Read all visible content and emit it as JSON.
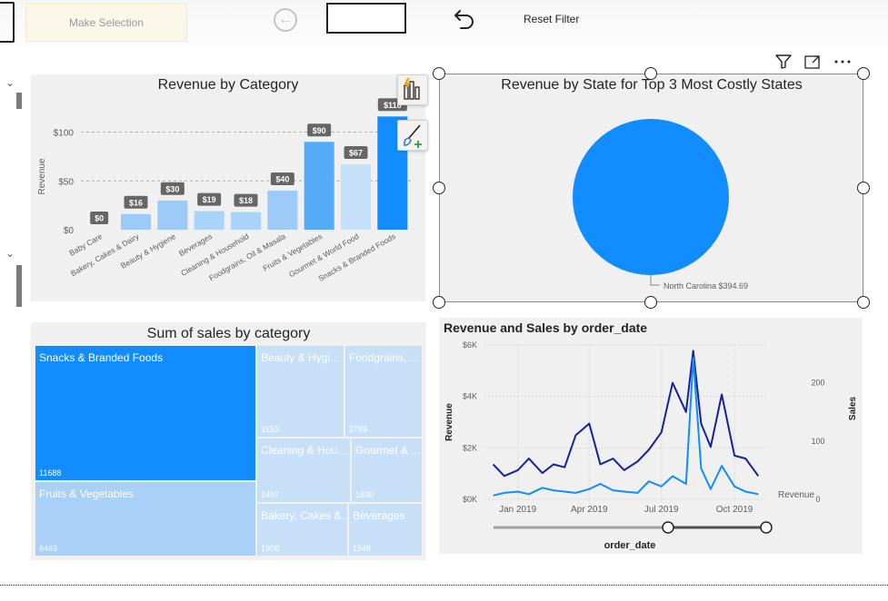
{
  "toolbar": {
    "make_selection_label": "Make Selection",
    "reset_filter_label": "Reset Filter"
  },
  "colors": {
    "accent_blue": "#118DFF",
    "light_blue": "#9DCBF7",
    "pale_blue": "#C5E0F9",
    "dark_navy": "#12239E",
    "card_bg": "#F0F0F0"
  },
  "chart_data": [
    {
      "type": "bar",
      "title": "Revenue by Category",
      "ylabel": "Revenue",
      "xlabel": "",
      "ylim": [
        0,
        120
      ],
      "yticks": [
        "$0",
        "$50",
        "$100"
      ],
      "ytick_values": [
        0,
        50,
        100
      ],
      "grid": true,
      "categories": [
        "Baby Care",
        "Bakery, Cakes & Dairy",
        "Beauty & Hygiene",
        "Beverages",
        "Cleaning & Household",
        "Foodgrains, Oil & Masala",
        "Fruits & Vegetables",
        "Gourmet & World Food",
        "Snacks & Branded Foods"
      ],
      "values": [
        0,
        16,
        30,
        19,
        18,
        40,
        90,
        67,
        116
      ],
      "data_labels": [
        "$0",
        "$16",
        "$30",
        "$19",
        "$18",
        "$40",
        "$90",
        "$67",
        "$116"
      ]
    },
    {
      "type": "pie",
      "title": "Revenue by State for Top 3 Most Costly States",
      "slices": [
        {
          "name": "North Carolina",
          "value": 394.69
        }
      ],
      "data_labels": [
        "North Carolina $394.69"
      ]
    },
    {
      "type": "treemap",
      "title": "Sum of sales by category",
      "items": [
        {
          "name": "Snacks & Branded Foods",
          "display_name": "Snacks & Branded Foods",
          "value": 11688
        },
        {
          "name": "Fruits & Vegetables",
          "display_name": "Fruits & Vegetables",
          "value": 6463
        },
        {
          "name": "Beauty & Hygiene",
          "display_name": "Beauty & Hygi...",
          "value": 3153
        },
        {
          "name": "Foodgrains, Oil & Masala",
          "display_name": "Foodgrains, ...",
          "value": 2799
        },
        {
          "name": "Cleaning & Household",
          "display_name": "Cleaning & Hou...",
          "value": 2407
        },
        {
          "name": "Gourmet & World Food",
          "display_name": "Gourmet & ...",
          "value": 1830
        },
        {
          "name": "Bakery, Cakes & Dairy",
          "display_name": "Bakery, Cakes &...",
          "value": 1908
        },
        {
          "name": "Beverages",
          "display_name": "Beverages",
          "value": 1548
        }
      ]
    },
    {
      "type": "line",
      "title": "Revenue and Sales by order_date",
      "xlabel": "order_date",
      "ylabel": "Revenue",
      "y2label": "Sales",
      "ylim": [
        0,
        6000
      ],
      "yticks": [
        "$0K",
        "$2K",
        "$4K",
        "$6K"
      ],
      "ytick_values": [
        0,
        2000,
        4000,
        6000
      ],
      "y2lim": [
        0,
        265
      ],
      "y2ticks": [
        "0",
        "100",
        "200"
      ],
      "y2tick_values": [
        0,
        100,
        200
      ],
      "xlim": [
        "2018-11-20",
        "2019-11-10"
      ],
      "xticks": [
        "Jan 2019",
        "Apr 2019",
        "Jul 2019",
        "Oct 2019"
      ],
      "xtick_values": [
        "2019-01-01",
        "2019-04-01",
        "2019-07-01",
        "2019-10-01"
      ],
      "legend_label": "Revenue",
      "series": [
        {
          "name": "Revenue",
          "axis": "left",
          "color": "#118DFF",
          "x": [
            "2018-12-01",
            "2018-12-15",
            "2019-01-01",
            "2019-01-15",
            "2019-02-01",
            "2019-02-15",
            "2019-03-01",
            "2019-03-15",
            "2019-04-01",
            "2019-04-15",
            "2019-05-01",
            "2019-05-15",
            "2019-06-01",
            "2019-06-15",
            "2019-07-01",
            "2019-07-15",
            "2019-08-01",
            "2019-08-10",
            "2019-08-20",
            "2019-09-01",
            "2019-09-15",
            "2019-10-01",
            "2019-10-15",
            "2019-10-31"
          ],
          "y": [
            150,
            250,
            300,
            200,
            450,
            350,
            300,
            250,
            400,
            600,
            350,
            300,
            250,
            700,
            500,
            900,
            600,
            5500,
            1200,
            400,
            1300,
            500,
            300,
            200
          ]
        },
        {
          "name": "Sales",
          "axis": "right",
          "color": "#12239E",
          "x": [
            "2018-12-01",
            "2018-12-15",
            "2019-01-01",
            "2019-01-15",
            "2019-02-01",
            "2019-02-15",
            "2019-03-01",
            "2019-03-15",
            "2019-04-01",
            "2019-04-15",
            "2019-05-01",
            "2019-05-15",
            "2019-06-01",
            "2019-06-15",
            "2019-07-01",
            "2019-07-15",
            "2019-08-01",
            "2019-08-10",
            "2019-08-20",
            "2019-09-01",
            "2019-09-15",
            "2019-10-01",
            "2019-10-15",
            "2019-10-31"
          ],
          "y": [
            60,
            40,
            50,
            70,
            45,
            60,
            55,
            110,
            130,
            60,
            70,
            50,
            65,
            85,
            115,
            200,
            150,
            255,
            130,
            90,
            180,
            75,
            70,
            40
          ]
        }
      ]
    }
  ]
}
